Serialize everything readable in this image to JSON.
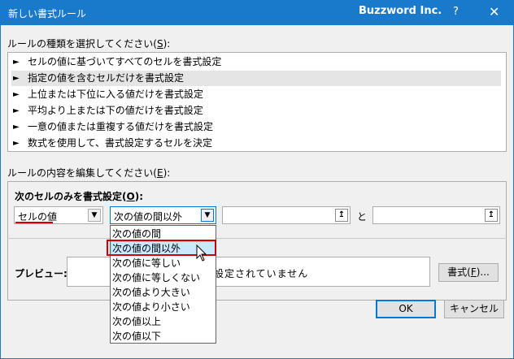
{
  "window": {
    "title": "新しい書式ルール",
    "brand": "Buzzword Inc.",
    "help": "?",
    "close": "✕"
  },
  "rule_type": {
    "label_pre": "ルールの種類を選択してください(",
    "label_key": "S",
    "label_post": "):",
    "arrow": "►",
    "items": [
      "セルの値に基づいてすべてのセルを書式設定",
      "指定の値を含むセルだけを書式設定",
      "上位または下位に入る値だけを書式設定",
      "平均より上または下の値だけを書式設定",
      "一意の値または重複する値だけを書式設定",
      "数式を使用して、書式設定するセルを決定"
    ],
    "selected_index": 1
  },
  "rule_edit": {
    "label_pre": "ルールの内容を編集してください(",
    "label_key": "E",
    "label_post": "):",
    "heading_pre": "次のセルのみを書式設定(",
    "heading_key": "O",
    "heading_post": "):",
    "cell_type": "セルの値",
    "operator": "次の値の間以外",
    "and_label": "と",
    "ref_icon": "↥",
    "combo_icon": "▼"
  },
  "operator_options": [
    "次の値の間",
    "次の値の間以外",
    "次の値に等しい",
    "次の値に等しくない",
    "次の値より大きい",
    "次の値より小さい",
    "次の値以上",
    "次の値以下"
  ],
  "operator_selected_index": 1,
  "preview": {
    "label": "プレビュー:",
    "text": "設定されていません"
  },
  "buttons": {
    "format_pre": "書式(",
    "format_key": "F",
    "format_post": ")...",
    "ok": "OK",
    "cancel": "キャンセル"
  },
  "colors": {
    "titlebar": "#1979ca",
    "highlight": "#d00000",
    "selection": "#cce8ff"
  }
}
